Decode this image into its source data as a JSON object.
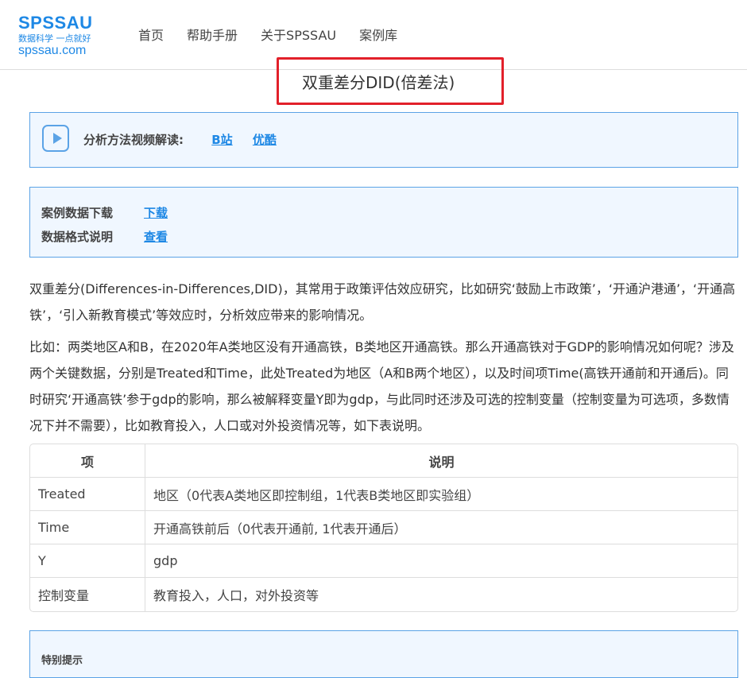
{
  "logo": {
    "line1": "SPSSAU",
    "line2": "数据科学 一点就好",
    "line3": "spssau.com"
  },
  "nav": [
    "首页",
    "帮助手册",
    "关于SPSSAU",
    "案例库"
  ],
  "title": "双重差分DID(倍差法)",
  "video": {
    "label": "分析方法视频解读:",
    "links": [
      "B站",
      "优酷"
    ]
  },
  "download": {
    "rows": [
      {
        "label": "案例数据下载",
        "link": "下载"
      },
      {
        "label": "数据格式说明",
        "link": "查看"
      }
    ]
  },
  "paragraphs": [
    "双重差分(Differences-in-Differences,DID)，其常用于政策评估效应研究，比如研究‘鼓励上市政策’，‘开通沪港通’，‘开通高铁’，‘引入新教育模式’等效应时，分析效应带来的影响情况。",
    "比如：两类地区A和B，在2020年A类地区没有开通高铁，B类地区开通高铁。那么开通高铁对于GDP的影响情况如何呢？涉及两个关键数据，分别是Treated和Time，此处Treated为地区（A和B两个地区），以及时间项Time(高铁开通前和开通后)。同时研究‘开通高铁’参于gdp的影响，那么被解释变量Y即为gdp，与此同时还涉及可选的控制变量（控制变量为可选项，多数情况下并不需要），比如教育投入，人口或对外投资情况等，如下表说明。"
  ],
  "table": {
    "headers": [
      "项",
      "说明"
    ],
    "rows": [
      [
        "Treated",
        "地区（0代表A类地区即控制组，1代表B类地区即实验组）"
      ],
      [
        "Time",
        "开通高铁前后（0代表开通前, 1代表开通后）"
      ],
      [
        "Y",
        "gdp"
      ],
      [
        "控制变量",
        "教育投入，人口，对外投资等"
      ]
    ]
  },
  "tip": "特别提示"
}
